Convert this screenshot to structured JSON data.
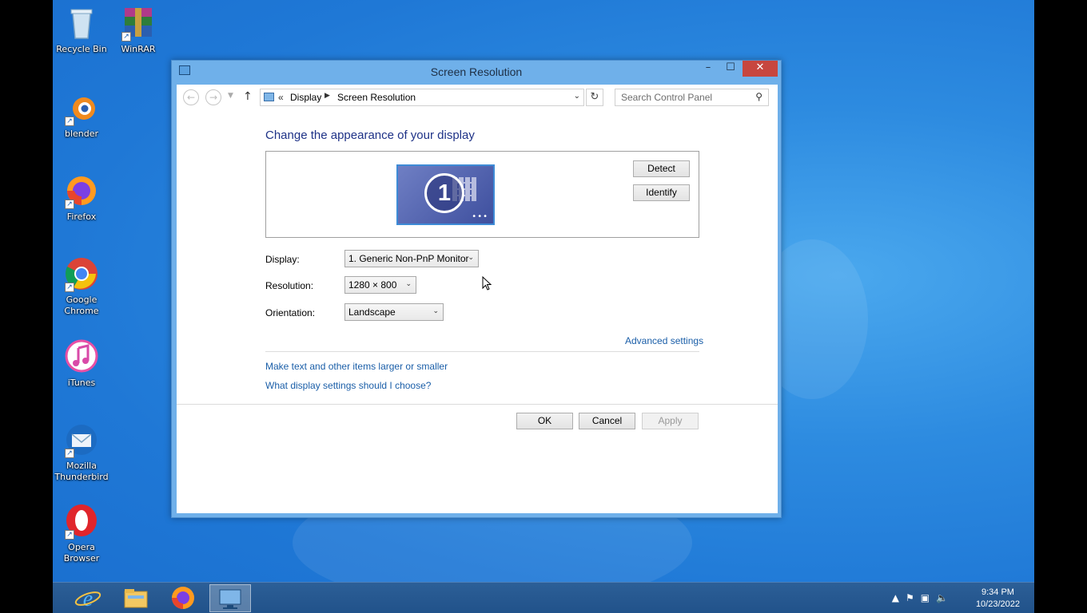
{
  "desktop": {
    "icons": [
      {
        "label": "Recycle Bin",
        "icon": "recycle-bin-icon"
      },
      {
        "label": "WinRAR",
        "icon": "winrar-icon"
      },
      {
        "label": "blender",
        "icon": "blender-icon"
      },
      {
        "label": "Firefox",
        "icon": "firefox-icon"
      },
      {
        "label": "Google Chrome",
        "icon": "chrome-icon"
      },
      {
        "label": "iTunes",
        "icon": "itunes-icon"
      },
      {
        "label": "Mozilla Thunderbird",
        "icon": "thunderbird-icon"
      },
      {
        "label": "Opera Browser",
        "icon": "opera-icon"
      }
    ]
  },
  "window": {
    "title": "Screen Resolution",
    "controls": {
      "minimize": "–",
      "maximize": "☐",
      "close": "✕"
    }
  },
  "address_bar": {
    "overflow": "«",
    "crumbs": [
      "Display",
      "Screen Resolution"
    ],
    "search_placeholder": "Search Control Panel"
  },
  "content": {
    "heading": "Change the appearance of your display",
    "monitor_number": "1",
    "detect_label": "Detect",
    "identify_label": "Identify",
    "display_label": "Display:",
    "display_value": "1. Generic Non-PnP Monitor",
    "resolution_label": "Resolution:",
    "resolution_value": "1280 × 800",
    "orientation_label": "Orientation:",
    "orientation_value": "Landscape",
    "advanced_link": "Advanced settings",
    "text_size_link": "Make text and other items larger or smaller",
    "help_link": "What display settings should I choose?"
  },
  "buttons": {
    "ok": "OK",
    "cancel": "Cancel",
    "apply": "Apply"
  },
  "taskbar": {
    "items": [
      "internet-explorer-icon",
      "file-explorer-icon",
      "firefox-icon",
      "screen-resolution-icon"
    ],
    "clock": {
      "time": "9:34 PM",
      "date": "10/23/2022"
    }
  },
  "colors": {
    "accent": "#6fb0ea",
    "close": "#c7463f",
    "link": "#1a5ea8",
    "heading": "#1e3287"
  }
}
